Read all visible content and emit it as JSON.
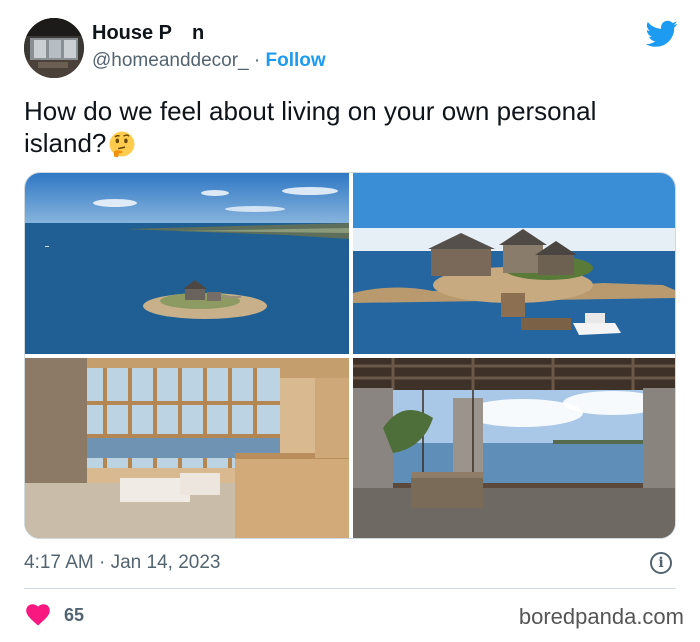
{
  "author": {
    "name": "House P n",
    "handle": "@homeanddecor_",
    "separator": "·",
    "follow_label": "Follow"
  },
  "tweet": {
    "text": "How do we feel about living on your own personal island?",
    "emoji": "thinking-face-emoji"
  },
  "media": {
    "photos": [
      {
        "name": "aerial island photo"
      },
      {
        "name": "stone cottage on island photo"
      },
      {
        "name": "timber interior photo"
      },
      {
        "name": "porch swing view photo"
      }
    ]
  },
  "meta": {
    "timestamp": "4:17 AM · Jan 14, 2023",
    "info_glyph": "i"
  },
  "engagement": {
    "likes": "65"
  },
  "watermark": "boredpanda.com",
  "colors": {
    "accent": "#1d9bf0",
    "heart": "#f91880",
    "text": "#0f1419",
    "muted": "#536471"
  }
}
